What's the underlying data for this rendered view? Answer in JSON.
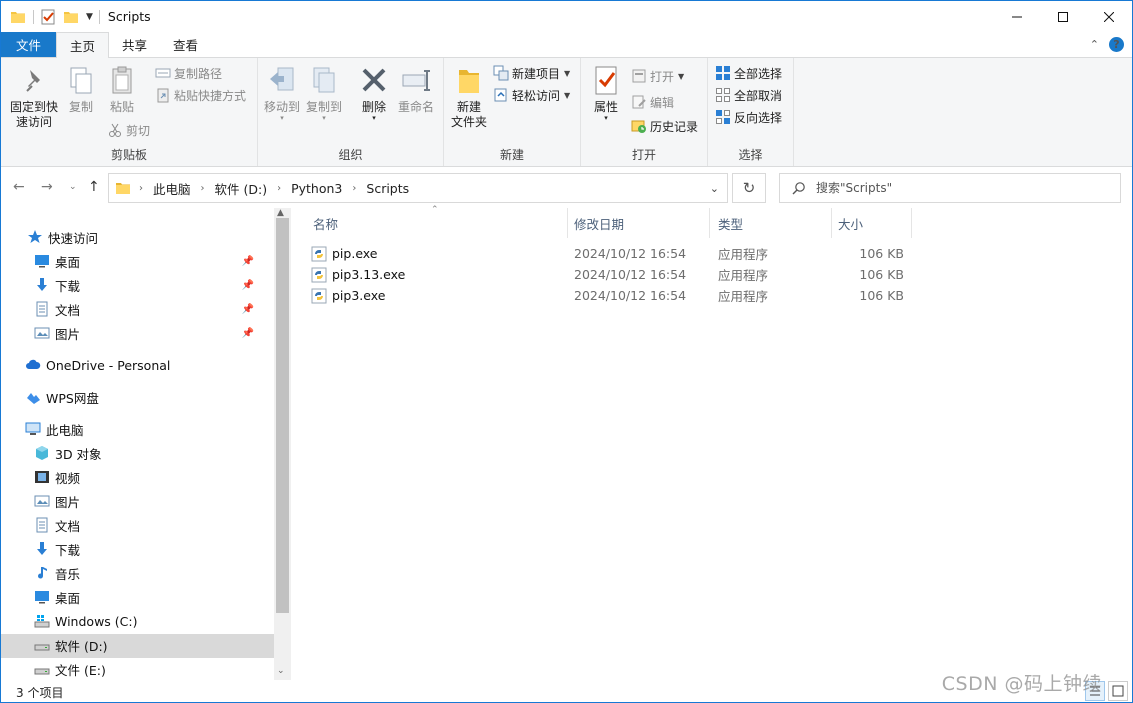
{
  "window": {
    "title": "Scripts",
    "watermark": "CSDN @码上钟续"
  },
  "ribbon_tabs": [
    {
      "label": "文件"
    },
    {
      "label": "主页"
    },
    {
      "label": "共享"
    },
    {
      "label": "查看"
    }
  ],
  "ribbon": {
    "clipboard": {
      "pin_label_1": "固定到快",
      "pin_label_2": "速访问",
      "copy": "复制",
      "paste": "粘贴",
      "copy_path": "复制路径",
      "paste_shortcut": "粘贴快捷方式",
      "cut": "剪切",
      "group": "剪贴板"
    },
    "organize": {
      "move_to": "移动到",
      "copy_to": "复制到",
      "delete": "删除",
      "rename": "重命名",
      "group": "组织"
    },
    "new": {
      "new_folder_1": "新建",
      "new_folder_2": "文件夹",
      "new_item": "新建项目",
      "easy_access": "轻松访问",
      "group": "新建"
    },
    "open": {
      "properties": "属性",
      "open": "打开",
      "edit": "编辑",
      "history": "历史记录",
      "group": "打开"
    },
    "select": {
      "select_all": "全部选择",
      "select_none": "全部取消",
      "invert": "反向选择",
      "group": "选择"
    }
  },
  "address": {
    "breadcrumbs": [
      "此电脑",
      "软件 (D:)",
      "Python3",
      "Scripts"
    ]
  },
  "search": {
    "placeholder": "搜索\"Scripts\""
  },
  "nav": {
    "quick_access": "快速访问",
    "qa_items": [
      {
        "label": "桌面",
        "icon": "desktop-icon"
      },
      {
        "label": "下载",
        "icon": "download-icon"
      },
      {
        "label": "文档",
        "icon": "document-icon"
      },
      {
        "label": "图片",
        "icon": "picture-icon"
      }
    ],
    "onedrive": "OneDrive - Personal",
    "wps": "WPS网盘",
    "this_pc": "此电脑",
    "pc_items": [
      {
        "label": "3D 对象",
        "icon": "3d-objects-icon"
      },
      {
        "label": "视频",
        "icon": "video-icon"
      },
      {
        "label": "图片",
        "icon": "picture-icon"
      },
      {
        "label": "文档",
        "icon": "document-icon"
      },
      {
        "label": "下载",
        "icon": "download-icon"
      },
      {
        "label": "音乐",
        "icon": "music-icon"
      },
      {
        "label": "桌面",
        "icon": "desktop-icon"
      },
      {
        "label": "Windows (C:)",
        "icon": "drive-c-icon"
      },
      {
        "label": "软件 (D:)",
        "icon": "drive-icon"
      },
      {
        "label": "文件 (E:)",
        "icon": "drive-icon"
      }
    ],
    "selected": "软件 (D:)"
  },
  "columns": {
    "name": "名称",
    "date": "修改日期",
    "type": "类型",
    "size": "大小"
  },
  "files": [
    {
      "name": "pip.exe",
      "date": "2024/10/12 16:54",
      "type": "应用程序",
      "size": "106 KB"
    },
    {
      "name": "pip3.13.exe",
      "date": "2024/10/12 16:54",
      "type": "应用程序",
      "size": "106 KB"
    },
    {
      "name": "pip3.exe",
      "date": "2024/10/12 16:54",
      "type": "应用程序",
      "size": "106 KB"
    }
  ],
  "status": {
    "count": "3 个项目"
  },
  "colors": {
    "accent": "#1979ca",
    "selection": "#d9d9d9",
    "header_text": "#4c607a"
  }
}
